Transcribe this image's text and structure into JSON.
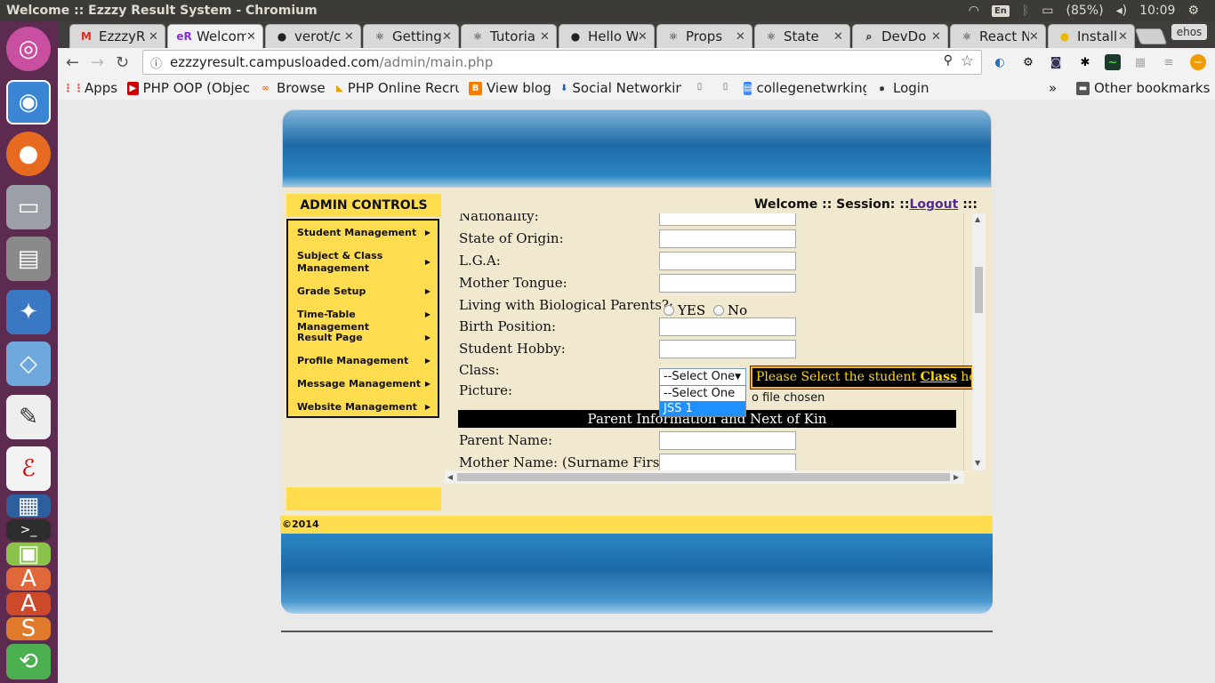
{
  "window_title": "Welcome :: Ezzzy Result System - Chromium",
  "system_tray": {
    "keyboard": "En",
    "battery": "(85%)",
    "time": "10:09"
  },
  "tabs": [
    {
      "label": "EzzzyR",
      "icon": "gmail-icon"
    },
    {
      "label": "Welcome",
      "icon": "site-icon"
    },
    {
      "label": "verot/c",
      "icon": "github-icon"
    },
    {
      "label": "Getting",
      "icon": "react-icon"
    },
    {
      "label": "Tutoria",
      "icon": "react-icon"
    },
    {
      "label": "Hello W",
      "icon": "github-icon"
    },
    {
      "label": "Props",
      "icon": "react-icon"
    },
    {
      "label": "State",
      "icon": "react-icon"
    },
    {
      "label": "DevDo",
      "icon": "search-icon"
    },
    {
      "label": "React N",
      "icon": "react-icon"
    },
    {
      "label": "Installi",
      "icon": "bulb-icon"
    }
  ],
  "profile_label": "ehos",
  "address": {
    "host": "ezzzyresult.campusloaded.com",
    "path": "/admin/main.php"
  },
  "bookmarks": [
    {
      "label": "Apps"
    },
    {
      "label": "PHP OOP (Objec"
    },
    {
      "label": "Browse"
    },
    {
      "label": "PHP Online Recru"
    },
    {
      "label": "View blog"
    },
    {
      "label": "Social Networkin"
    },
    {
      "label": ""
    },
    {
      "label": ""
    },
    {
      "label": "collegenetwrking"
    },
    {
      "label": "Login"
    }
  ],
  "bookmarks_more": "»",
  "other_bookmarks": "Other bookmarks",
  "admin_controls_title": "ADMIN CONTROLS",
  "admin_menu": [
    "Student Management",
    "Subject & Class Management",
    "Grade Setup",
    "Time-Table Management",
    "Result Page",
    "Profile Management",
    "Message Management",
    "Website Management"
  ],
  "session": {
    "prefix": "Welcome :: Session: ::",
    "logout": "Logout",
    "suffix": " :::"
  },
  "form": {
    "fields": [
      "Nationality:",
      "State of Origin:",
      "L.G.A:",
      "Mother Tongue:",
      "Living with Biological Parents?:",
      "Birth Position:",
      "Student Hobby:",
      "Class:",
      "Picture:"
    ],
    "radio_yes": "YES",
    "radio_no": "No",
    "class_select_value": "--Select One",
    "class_options": [
      "--Select One",
      "JSS 1"
    ],
    "file_status": "o file chosen",
    "tooltip_prefix": "Please Select the student ",
    "tooltip_bold": "Class",
    "tooltip_suffix": " here.",
    "section_title": "Parent Information and Next of Kin",
    "parent_fields": [
      "Parent Name:",
      "Mother Name: (Surname First)"
    ]
  },
  "footer_text": "©2014"
}
